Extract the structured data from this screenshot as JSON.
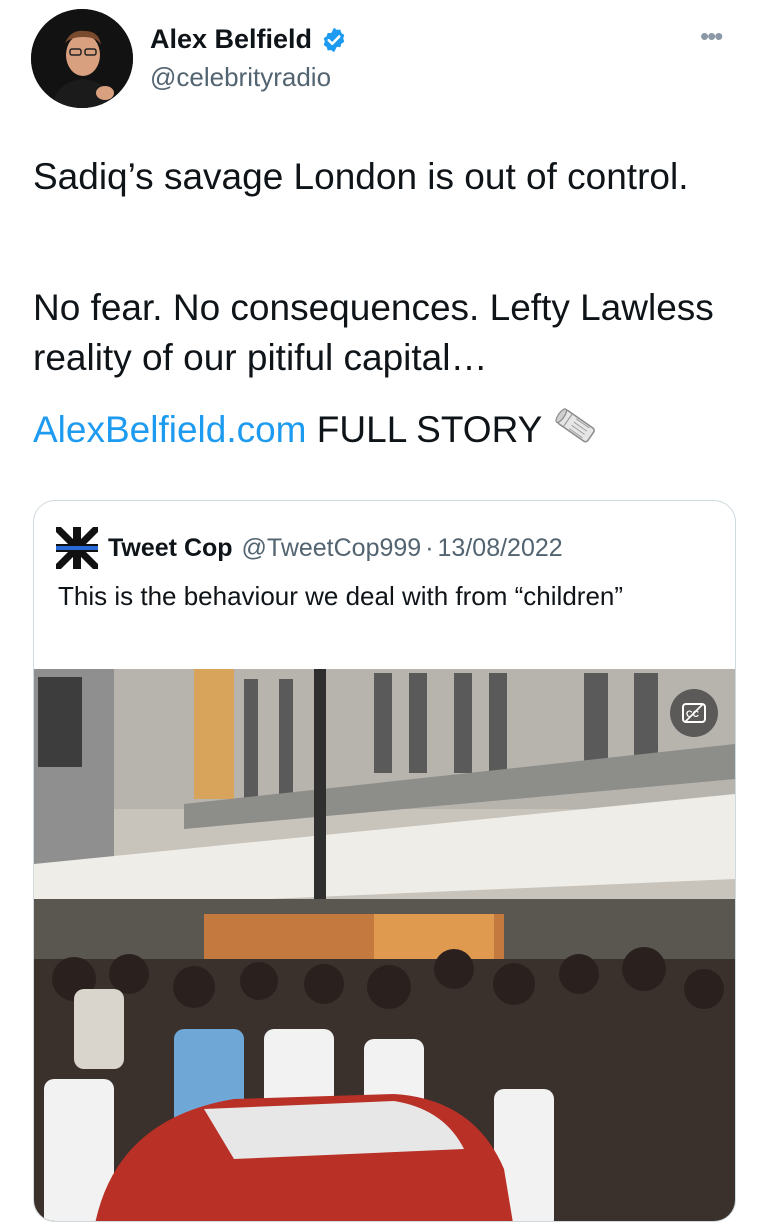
{
  "author": {
    "name": "Alex Belfield",
    "handle": "@celebrityradio",
    "verified": true,
    "avatar_icon": "profile-photo"
  },
  "menu_icon": "more-options-icon",
  "tweet": {
    "paragraph1": "Sadiq’s savage London is out of control.",
    "paragraph2": "No fear. No consequences. Lefty Lawless reality of our pitiful capital…",
    "link_text": "AlexBelfield.com",
    "link_after": " FULL STORY",
    "emoji": "rolled-newspaper-icon"
  },
  "quoted_tweet": {
    "name": "Tweet Cop",
    "handle": "@TweetCop999",
    "separator": "·",
    "date": "13/08/2022",
    "text": "This is the behaviour we deal with from “children”",
    "avatar_icon": "thin-blue-line-flag-icon",
    "media": {
      "type": "video",
      "caption_button_icon": "closed-captions-icon"
    }
  },
  "colors": {
    "link": "#1d9bf0",
    "secondary_text": "#536471",
    "verified_badge": "#1d9bf0",
    "border": "#cfd9de"
  }
}
